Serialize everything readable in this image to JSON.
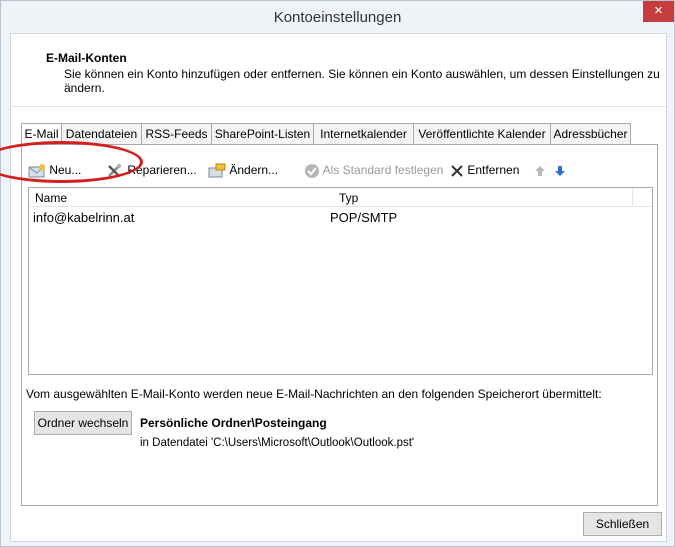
{
  "window": {
    "title": "Kontoeinstellungen",
    "close_label": "×"
  },
  "header": {
    "title": "E-Mail-Konten",
    "description": "Sie können ein Konto hinzufügen oder entfernen. Sie können ein Konto auswählen, um dessen Einstellungen zu ändern."
  },
  "tabs": [
    "E-Mail",
    "Datendateien",
    "RSS-Feeds",
    "SharePoint-Listen",
    "Internetkalender",
    "Veröffentlichte Kalender",
    "Adressbücher"
  ],
  "toolbar": {
    "new_label": "Neu...",
    "repair_label": "Reparieren...",
    "change_label": "Ändern...",
    "default_label": "Als Standard festlegen",
    "remove_label": "Entfernen"
  },
  "accounts": {
    "columns": {
      "name": "Name",
      "type": "Typ"
    },
    "rows": [
      {
        "name": "info@kabelrinn.at",
        "type": "POP/SMTP"
      }
    ]
  },
  "delivery": {
    "info": "Vom ausgewählten E-Mail-Konto werden neue E-Mail-Nachrichten an den folgenden Speicherort übermittelt:",
    "change_folder_label": "Ordner wechseln",
    "folder_name": "Persönliche Ordner\\Posteingang",
    "folder_path": "in Datendatei 'C:\\Users\\Microsoft\\Outlook\\Outlook.pst'"
  },
  "footer": {
    "close_label": "Schließen"
  },
  "colors": {
    "close_button": "#c73c3c",
    "highlight_ellipse": "#d41f1f"
  }
}
